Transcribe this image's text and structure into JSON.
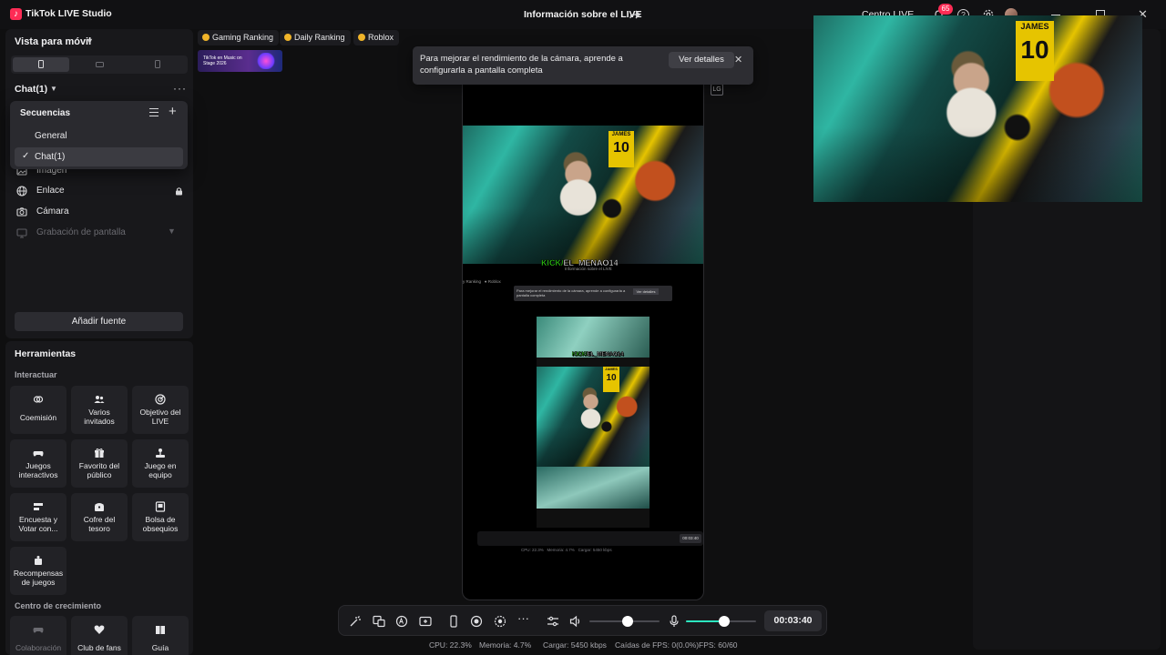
{
  "app": {
    "title": "TikTok LIVE Studio",
    "window_title": "Información sobre el LIVE",
    "live_center": "Centro LIVE",
    "notifications_count": "65"
  },
  "sidebar": {
    "view_mode": "Vista para móvil",
    "scene_selector": "Chat(1)",
    "sequences_menu": {
      "title": "Secuencias",
      "items": [
        {
          "label": "General",
          "selected": false
        },
        {
          "label": "Chat(1)",
          "selected": true
        }
      ]
    },
    "sources": [
      {
        "label": "Imagen",
        "icon": "image-icon"
      },
      {
        "label": "Enlace",
        "icon": "globe-icon",
        "locked": true
      },
      {
        "label": "Cámara",
        "icon": "camera-icon"
      },
      {
        "label": "Grabación de pantalla",
        "icon": "monitor-icon",
        "disabled": true
      }
    ],
    "add_source_label": "Añadir fuente"
  },
  "tools": {
    "title": "Herramientas",
    "interact_label": "Interactuar",
    "growth_label": "Centro de crecimiento",
    "items": [
      {
        "label": "Coemisión",
        "icon": "link-icon"
      },
      {
        "label": "Varios invitados",
        "icon": "users-icon"
      },
      {
        "label": "Objetivo del LIVE",
        "icon": "target-icon"
      },
      {
        "label": "Juegos interactivos",
        "icon": "gamepad-icon"
      },
      {
        "label": "Favorito del público",
        "icon": "gift-icon"
      },
      {
        "label": "Juego en equipo",
        "icon": "joystick-icon"
      },
      {
        "label": "Encuesta y Votar con...",
        "icon": "poll-icon"
      },
      {
        "label": "Cofre del tesoro",
        "icon": "chest-icon"
      },
      {
        "label": "Bolsa de obsequios",
        "icon": "bag-icon"
      },
      {
        "label": "Recompensas de juegos",
        "icon": "reward-icon"
      }
    ],
    "growth_items": [
      {
        "label": "Colaboración",
        "icon": "gamepad-icon"
      },
      {
        "label": "Club de fans",
        "icon": "heart-icon"
      },
      {
        "label": "Guía",
        "icon": "book-icon"
      }
    ]
  },
  "canvas": {
    "chips": [
      {
        "label": "Gaming Ranking"
      },
      {
        "label": "Daily Ranking"
      },
      {
        "label": "Roblox"
      }
    ],
    "promo_text": "TikTok en Music on Stage 2026",
    "toast": {
      "text": "Para mejorar el rendimiento de la cámara, aprende a configurarla a pantalla completa",
      "button": "Ver detalles"
    },
    "overlay_tag_prefix": "KICK/",
    "overlay_tag_name": "EL_MENAO14",
    "overlay_subtitle": "Información sobre el LIVE",
    "jersey_text": "JAMES",
    "jersey_number": "10"
  },
  "toolbar": {
    "timer": "00:03:40",
    "volume_level": 0.55,
    "mic_level": 0.55
  },
  "status": {
    "cpu": "CPU:  22.3%",
    "memory": "Memoria:  4.7%",
    "upload": "Cargar:  5450 kbps",
    "dropped": "Caídas de FPS:  0(0.0%)",
    "fps": "FPS:  60/60"
  }
}
